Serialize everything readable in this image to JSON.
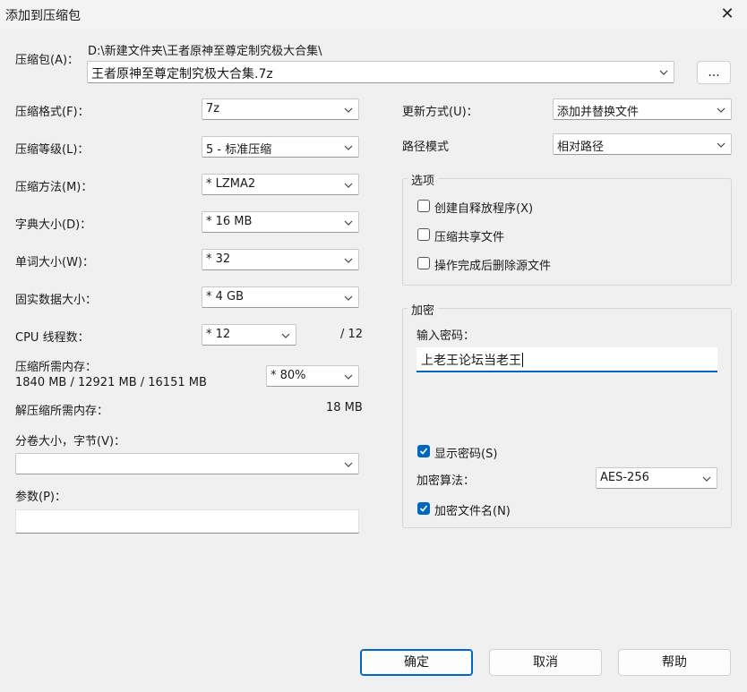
{
  "window": {
    "title": "添加到压缩包"
  },
  "archive": {
    "label": "压缩包(A)：",
    "path": "D:\\新建文件夹\\王者原神至尊定制究极大合集\\",
    "filename": "王者原神至尊定制究极大合集.7z",
    "browse_label": "..."
  },
  "options_left": [
    {
      "label": "压缩格式(F)：",
      "value": "7z"
    },
    {
      "label": "压缩等级(L)：",
      "value": "5 - 标准压缩"
    },
    {
      "label": "压缩方法(M)：",
      "value": "*  LZMA2"
    },
    {
      "label": "字典大小(D)：",
      "value": "*  16 MB"
    },
    {
      "label": "单词大小(W)：",
      "value": "*  32"
    },
    {
      "label": "固实数据大小：",
      "value": "*  4 GB"
    }
  ],
  "cpu": {
    "label": "CPU 线程数：",
    "value": "*  12",
    "total": "/ 12"
  },
  "memory": {
    "label": "压缩所需内存：",
    "detail": "1840 MB / 12921 MB / 16151 MB",
    "percent": "* 80%",
    "decompress_label": "解压缩所需内存：",
    "decompress_value": "18 MB"
  },
  "split": {
    "label": "分卷大小，字节(V)：",
    "value": ""
  },
  "params": {
    "label": "参数(P)：",
    "value": ""
  },
  "update": {
    "label": "更新方式(U)：",
    "value": "添加并替换文件"
  },
  "pathmode": {
    "label": "路径模式",
    "value": "相对路径"
  },
  "options_group": {
    "title": "选项",
    "items": [
      {
        "label": "创建自释放程序(X)",
        "checked": false
      },
      {
        "label": "压缩共享文件",
        "checked": false
      },
      {
        "label": "操作完成后删除源文件",
        "checked": false
      }
    ]
  },
  "encryption": {
    "title": "加密",
    "password_label": "输入密码：",
    "password": "上老王论坛当老王",
    "show_password_label": "显示密码(S)",
    "show_password": true,
    "method_label": "加密算法：",
    "method": "AES-256",
    "encrypt_names_label": "加密文件名(N)",
    "encrypt_names": true
  },
  "buttons": {
    "ok": "确定",
    "cancel": "取消",
    "help": "帮助"
  },
  "colors": {
    "accent": "#0067c0",
    "background": "#f0f0f0"
  }
}
